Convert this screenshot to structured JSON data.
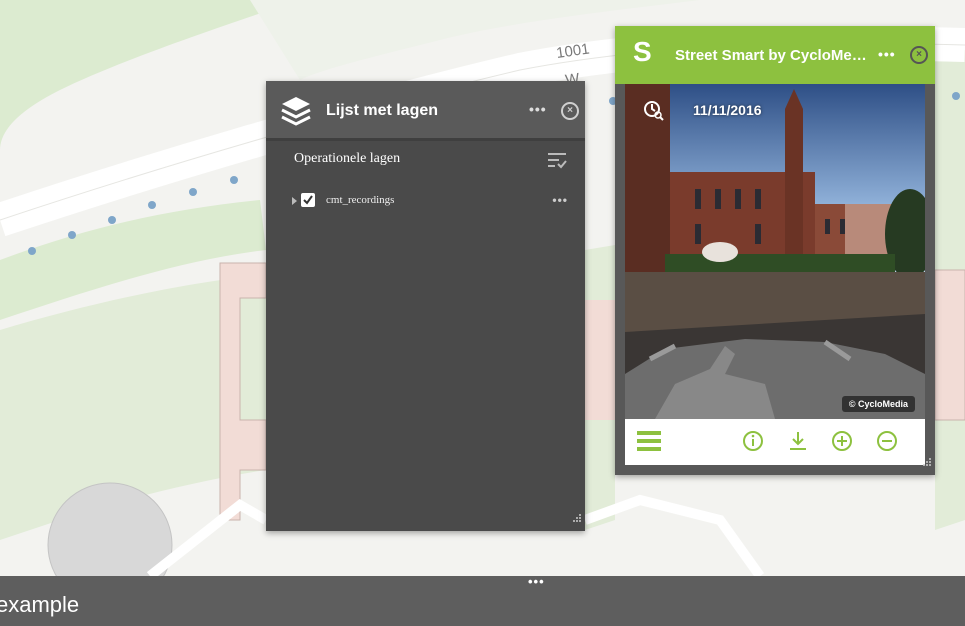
{
  "map": {
    "label_street": "1001",
    "label_w": "W"
  },
  "layer_list": {
    "title": "Lijst met lagen",
    "more": "•••",
    "close": "×",
    "section_title": "Operationele lagen",
    "layers": [
      {
        "name": "cmt_recordings",
        "checked": true,
        "more": "•••"
      }
    ]
  },
  "street_smart": {
    "logo": "S",
    "title": "Street Smart by CycloMedia",
    "more": "•••",
    "close": "×",
    "date": "11/11/2016",
    "copyright": "© CycloMedia",
    "toolbar": [
      "menu-icon",
      "info-icon",
      "download-icon",
      "zoom-in-icon",
      "zoom-out-icon"
    ],
    "accent": "#8dc13f"
  },
  "bottom_bar": {
    "more": "•••",
    "text": "example"
  }
}
